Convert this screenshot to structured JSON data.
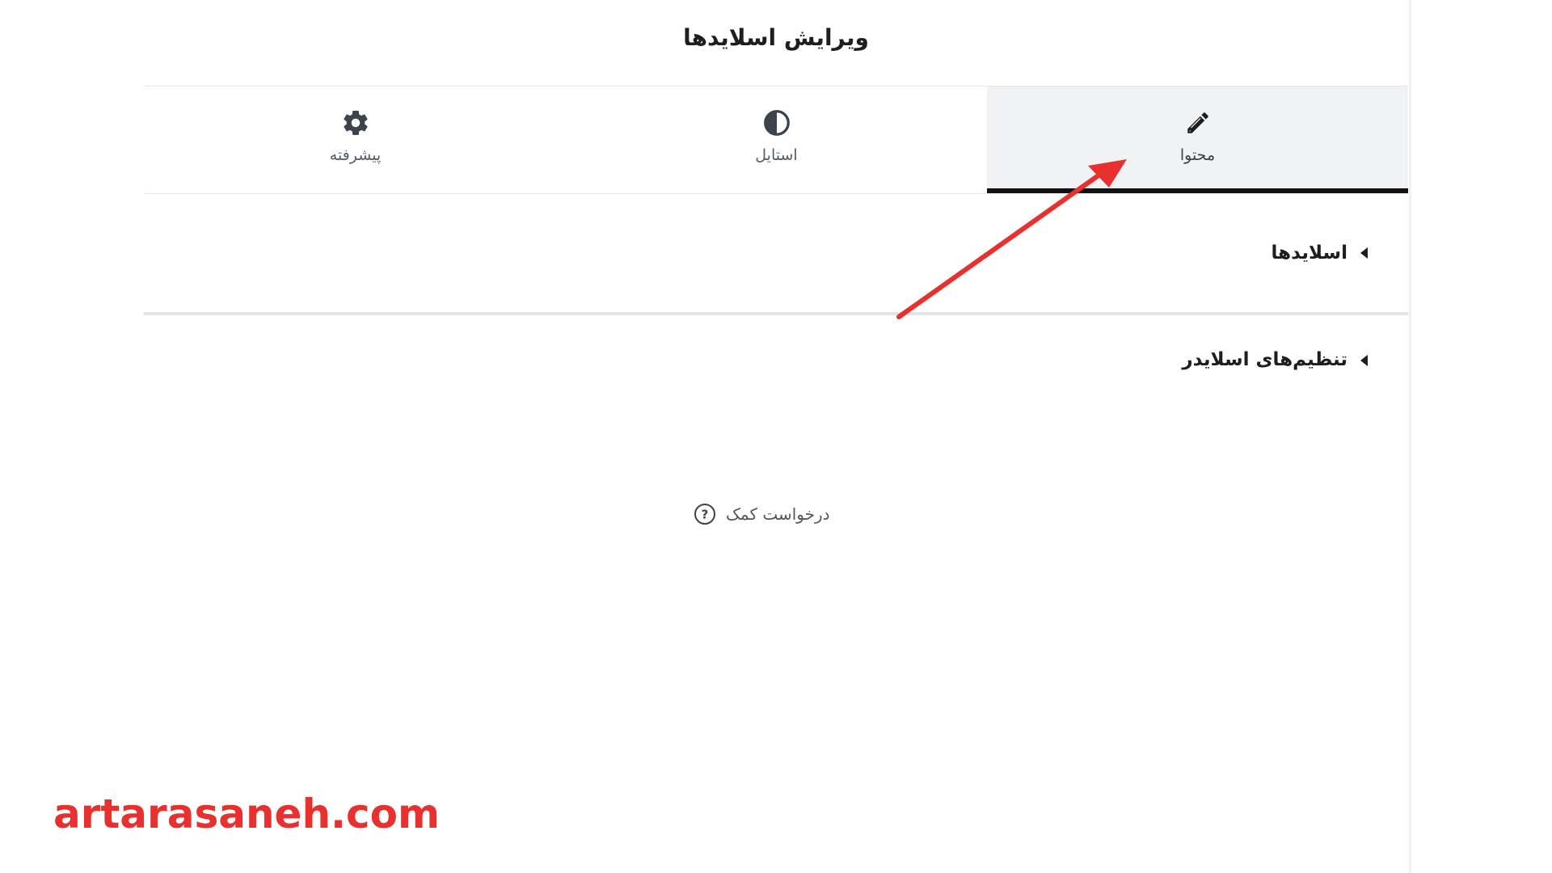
{
  "panel": {
    "title": "ویرایش اسلایدها"
  },
  "tabs": [
    {
      "label": "محتوا",
      "icon": "pencil-icon",
      "active": true
    },
    {
      "label": "استایل",
      "icon": "half-circle-icon",
      "active": false
    },
    {
      "label": "پیشرفته",
      "icon": "gear-icon",
      "active": false
    }
  ],
  "sections": [
    {
      "label": "اسلایدها",
      "icon": "caret-left-icon"
    },
    {
      "label": "تنظیم‌های اسلایدر",
      "icon": "caret-left-icon"
    }
  ],
  "help": {
    "label": "درخواست کمک",
    "icon": "question-circle-icon"
  },
  "watermark": {
    "text": "artarasaneh.com"
  },
  "colors": {
    "annotation_arrow": "#e8302f",
    "watermark": "#e8302f",
    "active_tab_bg": "#f1f2f4",
    "active_tab_indicator": "#111111"
  }
}
